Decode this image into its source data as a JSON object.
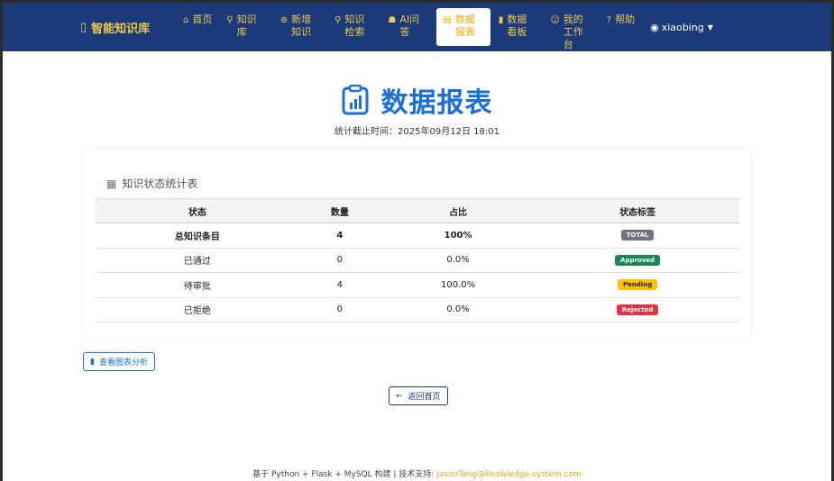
{
  "nav": {
    "brand": "智能知识库",
    "items": [
      {
        "icon": "home-icon",
        "glyph": "⌂",
        "label": "首页",
        "active": false
      },
      {
        "icon": "search-icon",
        "glyph": "⚲",
        "label": "知识库",
        "active": false
      },
      {
        "icon": "plus-circle-icon",
        "glyph": "⊕",
        "label": "新增知识",
        "active": false
      },
      {
        "icon": "search-icon",
        "glyph": "⚲",
        "label": "知识检索",
        "active": false
      },
      {
        "icon": "robot-icon",
        "glyph": "☗",
        "label": "AI问答",
        "active": false
      },
      {
        "icon": "report-icon",
        "glyph": "▤",
        "label": "数据报表",
        "active": true
      },
      {
        "icon": "bar-chart-icon",
        "glyph": "▮",
        "label": "数据看板",
        "active": false
      },
      {
        "icon": "person-icon",
        "glyph": "☺",
        "label": "我的工作台",
        "active": false
      },
      {
        "icon": "question-icon",
        "glyph": "?",
        "label": "帮助",
        "active": false
      }
    ],
    "user": "xiaobing"
  },
  "page": {
    "title": "数据报表",
    "timestamp": "统计截止时间：2025年09月12日 18:01"
  },
  "table": {
    "title": "知识状态统计表",
    "headers": [
      "状态",
      "数量",
      "占比",
      "状态标签"
    ],
    "rows": [
      {
        "status": "总知识条目",
        "count": "4",
        "ratio": "100%",
        "badge": "TOTAL",
        "badge_color": "#6c757d",
        "bold": true
      },
      {
        "status": "已通过",
        "count": "0",
        "ratio": "0.0%",
        "badge": "Approved",
        "badge_color": "#198754",
        "bold": false
      },
      {
        "status": "待审批",
        "count": "4",
        "ratio": "100.0%",
        "badge": "Pending",
        "badge_color": "#ffc107",
        "bold": false
      },
      {
        "status": "已拒绝",
        "count": "0",
        "ratio": "0.0%",
        "badge": "Rejected",
        "badge_color": "#dc3545",
        "bold": false
      }
    ]
  },
  "buttons": {
    "chart_analysis": "查看图表分析",
    "back_home": "返回首页"
  },
  "footer": {
    "text": "基于 Python + Flask + MySQL 构建 | 技术支持: ",
    "contact": "JasonTang@knowledge-system.com"
  }
}
